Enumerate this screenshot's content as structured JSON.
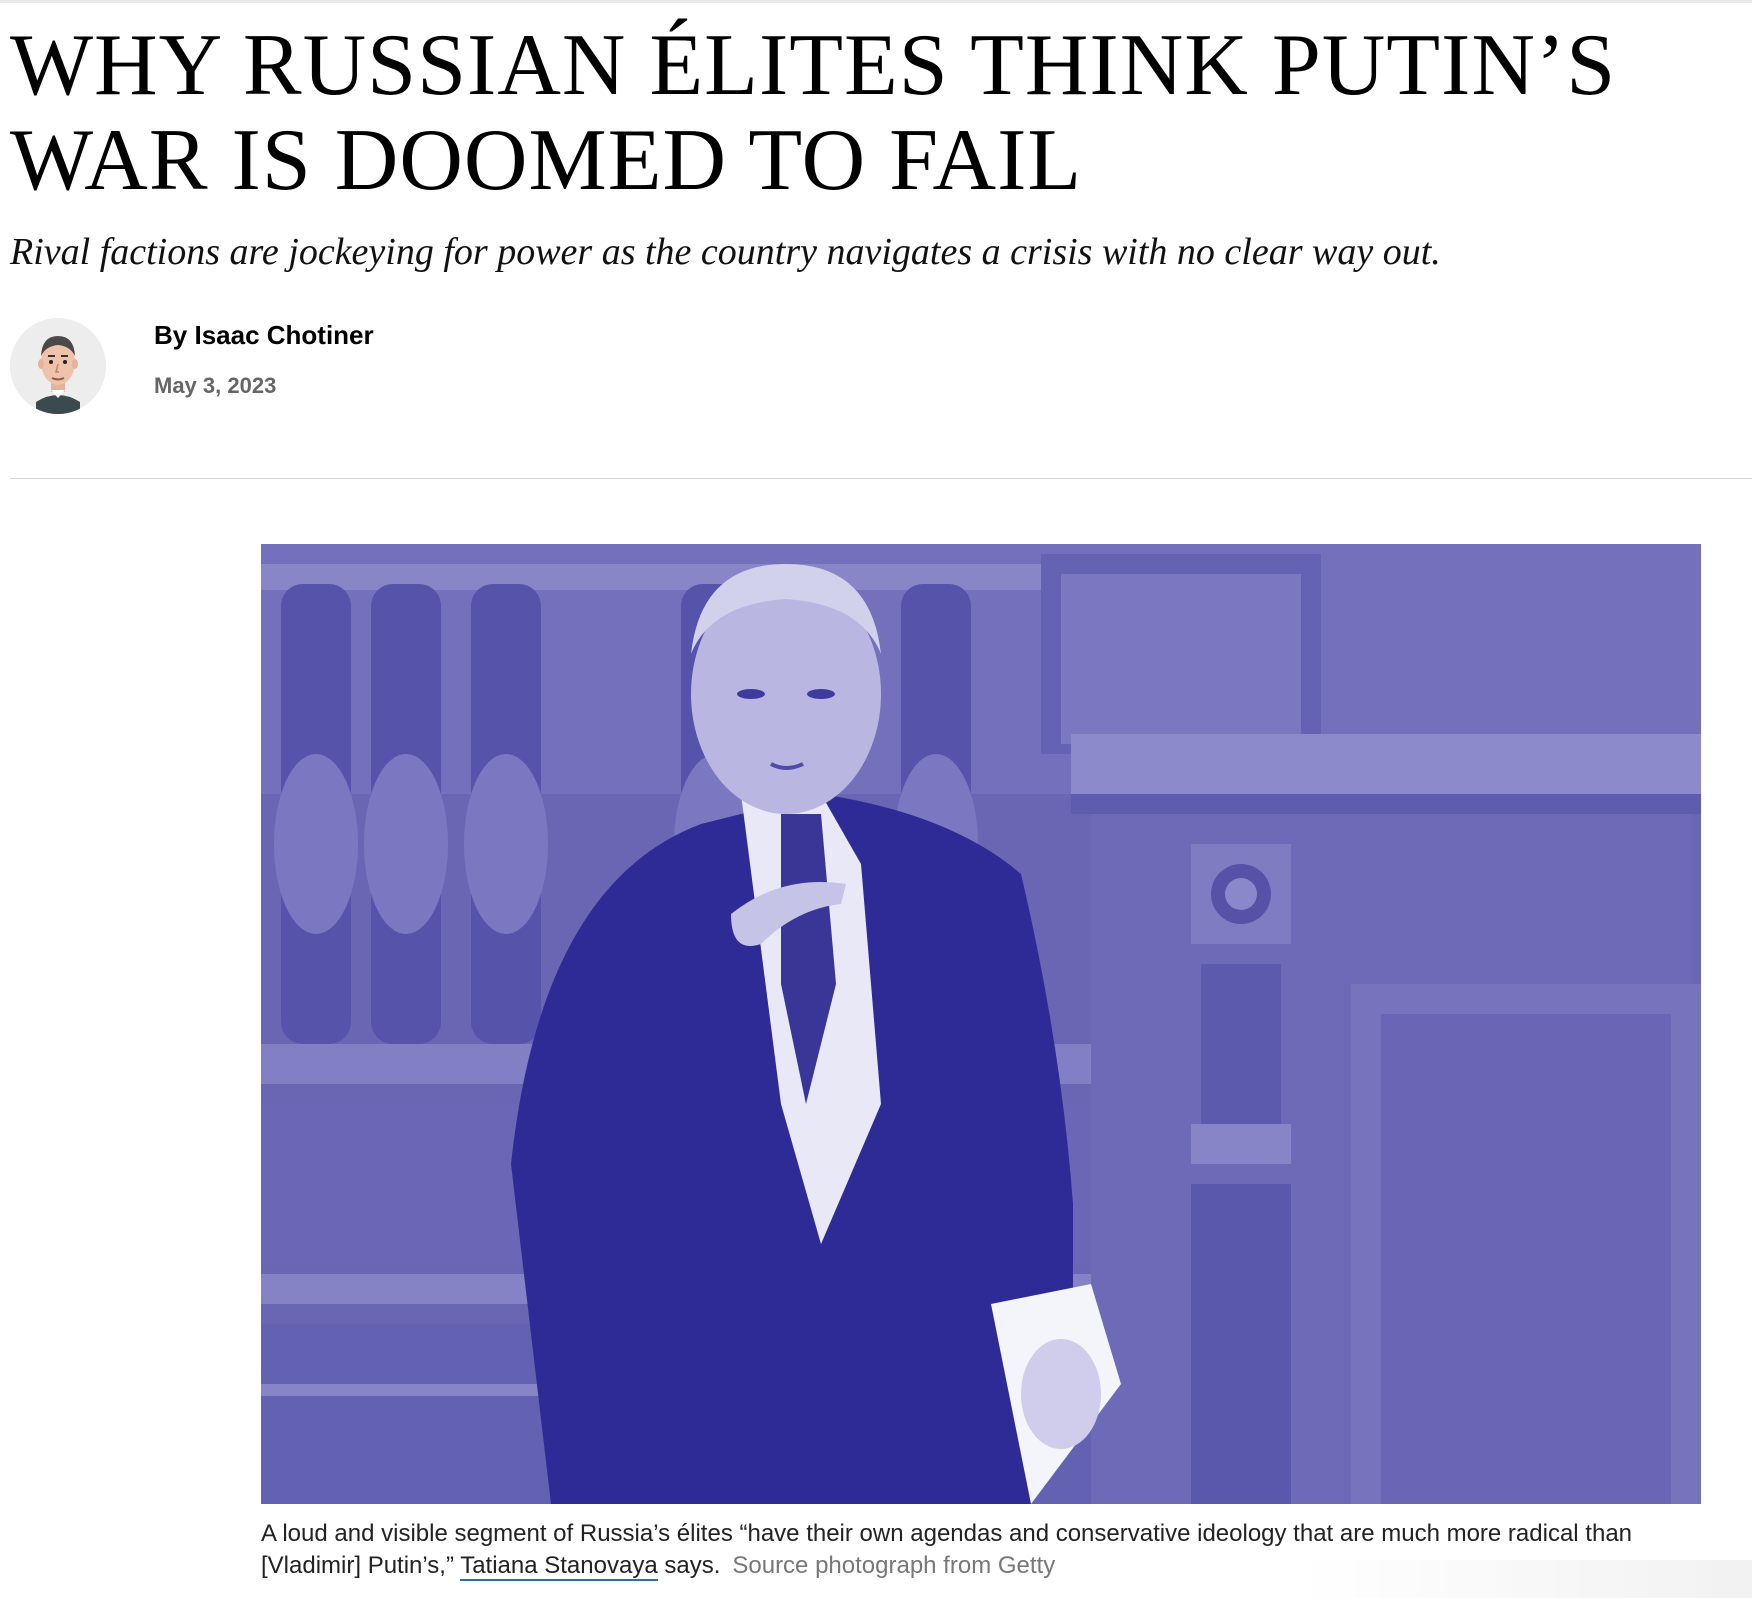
{
  "article": {
    "headline": "WHY RUSSIAN ÉLITES THINK PUTIN’S WAR IS DOOMED TO FAIL",
    "dek": "Rival factions are jockeying for power as the country navigates a crisis with no clear way out.",
    "byline": {
      "prefix": "By ",
      "author": "Isaac Chotiner",
      "date": "May 3, 2023"
    },
    "hero": {
      "caption_text": "A loud and visible segment of Russia’s élites “have their own agendas and conservative ideology that are much more radical than [Vladimir] Putin’s,” ",
      "caption_link": "Tatiana Stanovaya",
      "caption_end": " says.",
      "credit": "Source photograph from Getty"
    }
  },
  "colors": {
    "duotone_dark": "#3d3aa8",
    "duotone_light": "#f3f2fb",
    "link_underline": "#2a6fa8"
  }
}
